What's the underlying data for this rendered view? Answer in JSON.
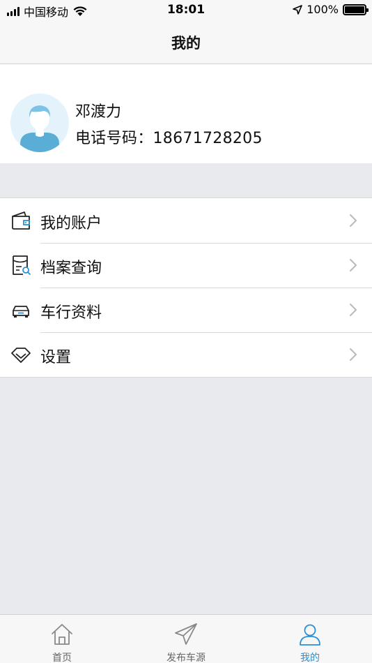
{
  "status_bar": {
    "carrier": "中国移动",
    "time": "18:01",
    "battery_text": "100%",
    "icons": [
      "signal-icon",
      "wifi-icon",
      "location-arrow-icon",
      "battery-icon"
    ]
  },
  "nav": {
    "title": "我的"
  },
  "profile": {
    "name": "邓渡力",
    "phone": "电话号码：18671728205",
    "avatar_icon": "user-avatar-icon"
  },
  "menu": {
    "items": [
      {
        "label": "我的账户",
        "icon": "wallet-icon"
      },
      {
        "label": "档案查询",
        "icon": "file-search-icon"
      },
      {
        "label": "车行资料",
        "icon": "car-icon"
      },
      {
        "label": "设置",
        "icon": "diamond-icon"
      }
    ],
    "chevron_icon": "chevron-right-icon"
  },
  "tab_bar": {
    "tabs": [
      {
        "label": "首页",
        "icon": "home-icon",
        "active": false
      },
      {
        "label": "发布车源",
        "icon": "paper-plane-icon",
        "active": false
      },
      {
        "label": "我的",
        "icon": "person-icon",
        "active": true
      }
    ]
  },
  "colors": {
    "accent": "#2a8fd4",
    "page_background": "#e8eaee",
    "bar_background": "#f7f7f7",
    "inactive_tab": "#666666",
    "avatar_bg": "#e4f3fb",
    "avatar_figure": "#5aaed6"
  }
}
